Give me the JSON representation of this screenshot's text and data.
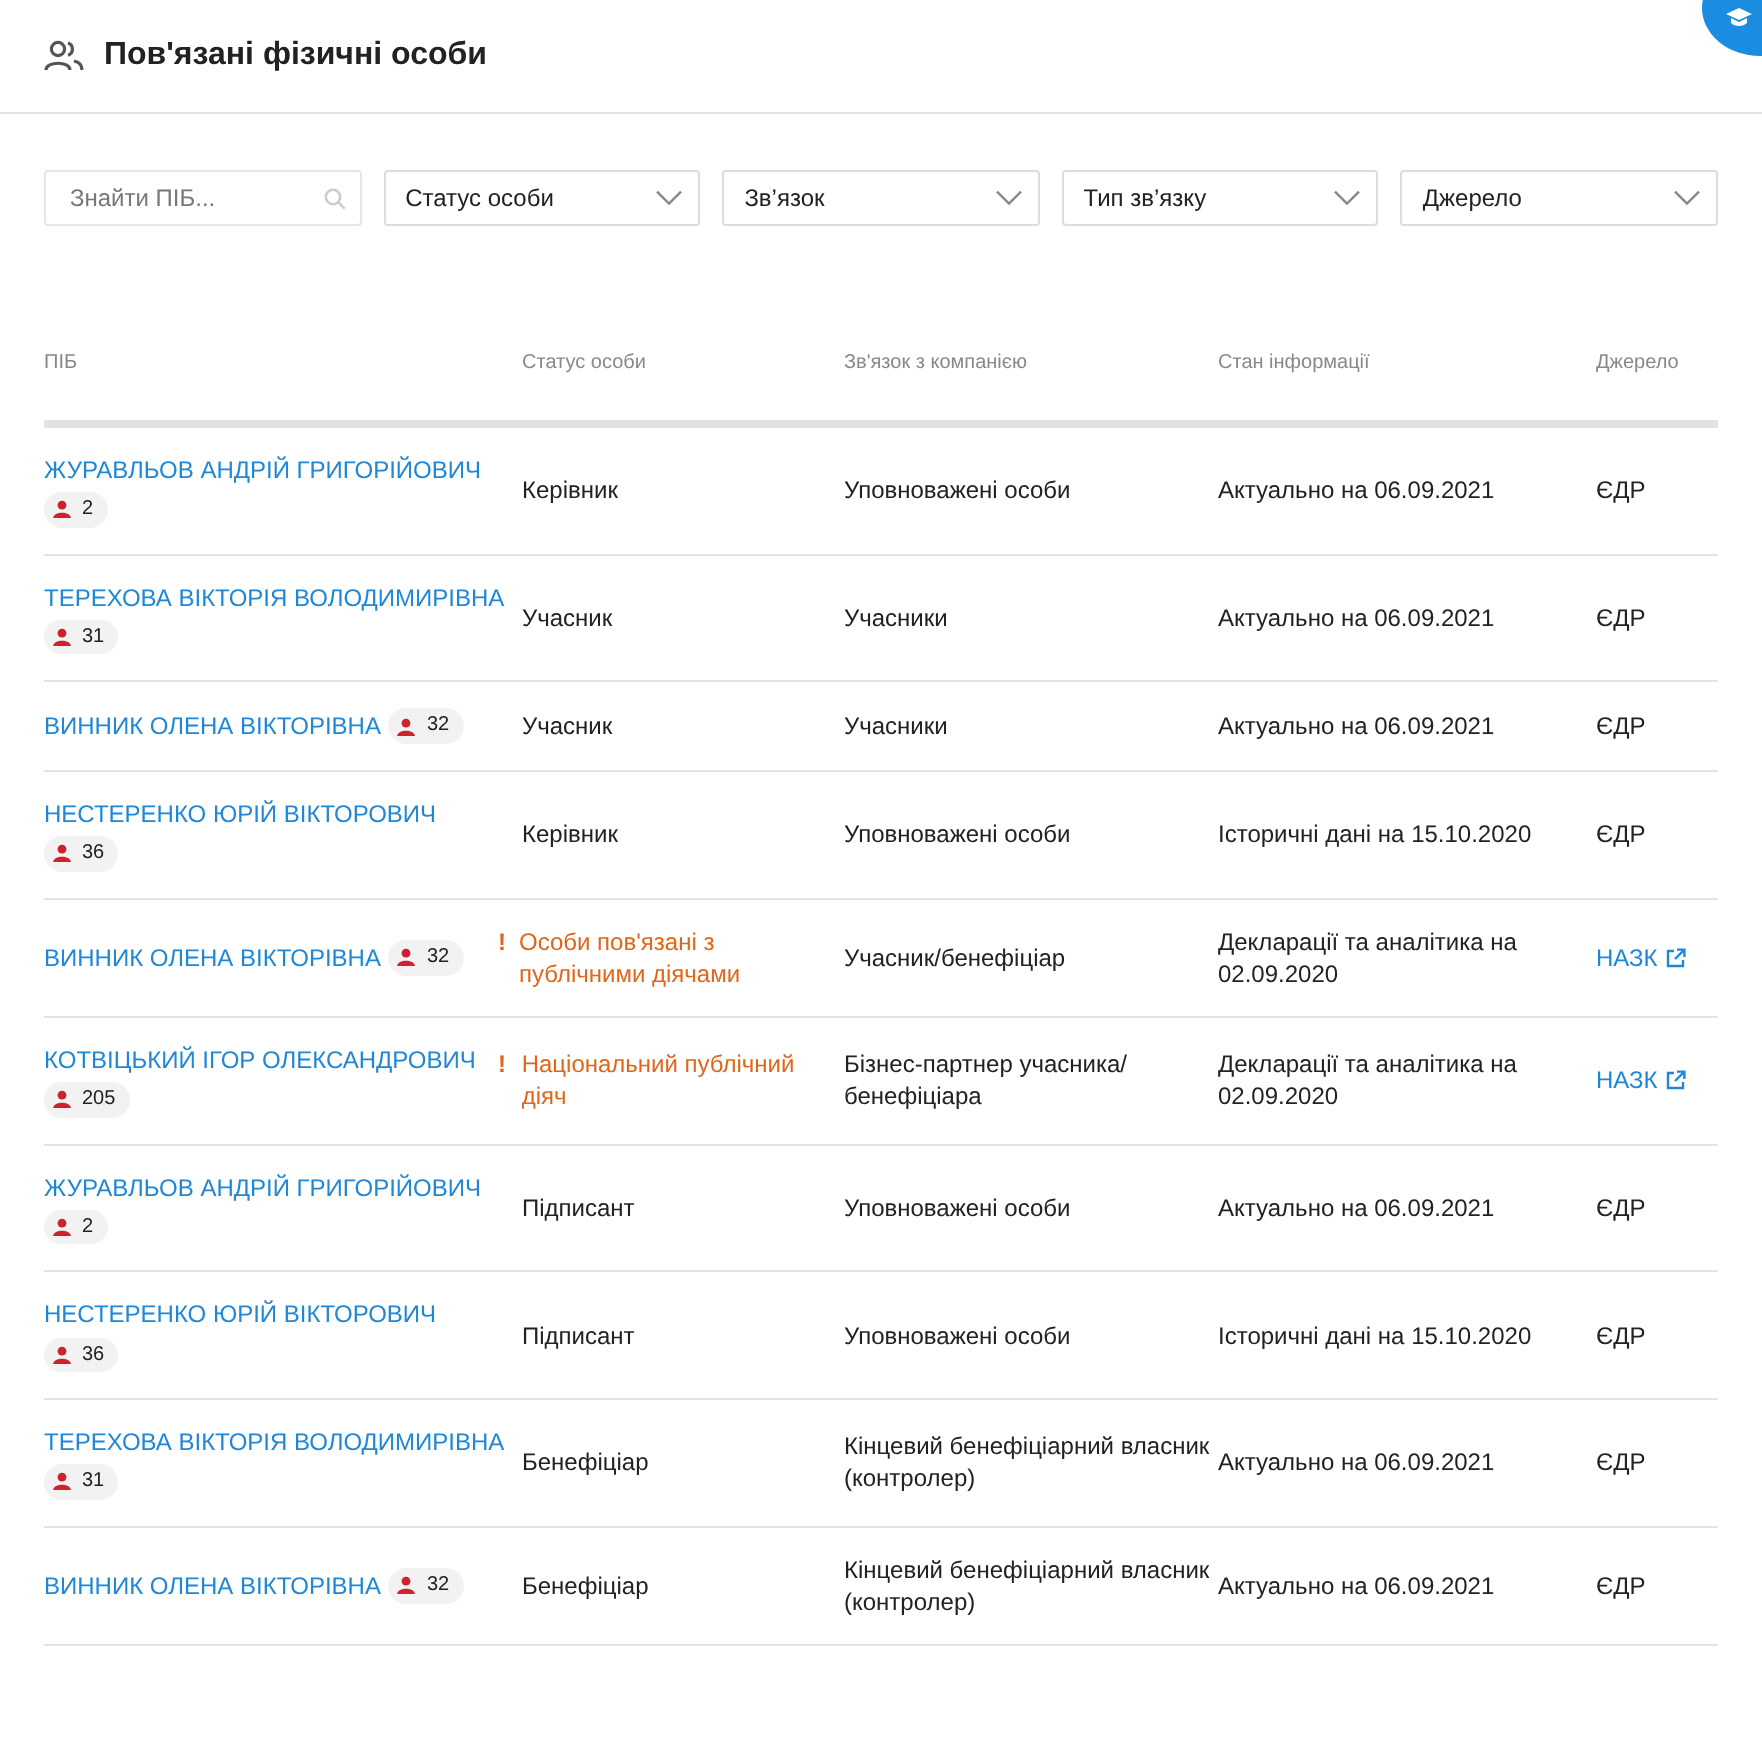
{
  "header": {
    "title": "Пов'язані фізичні особи"
  },
  "filters": [
    {
      "kind": "search",
      "placeholder": "Знайти ПІБ..."
    },
    {
      "kind": "select",
      "label": "Статус особи"
    },
    {
      "kind": "select",
      "label": "Зв’язок"
    },
    {
      "kind": "select",
      "label": "Тип зв’язку"
    },
    {
      "kind": "select",
      "label": "Джерело"
    }
  ],
  "table": {
    "columns": [
      "ПІБ",
      "Статус особи",
      "Зв'язок з компанією",
      "Стан інформації",
      "Джерело"
    ],
    "rows": [
      {
        "name": "ЖУРАВЛЬОВ АНДРІЙ ГРИГОРІЙОВИЧ",
        "count": "2",
        "status": "Керівник",
        "warning": false,
        "relation": "Уповноважені особи",
        "info": "Актуально на 06.09.2021",
        "source": "ЄДР",
        "external": false
      },
      {
        "name": "ТЕРЕХОВА ВІКТОРІЯ ВОЛОДИМИРІВНА",
        "count": "31",
        "status": "Учасник",
        "warning": false,
        "relation": "Учасники",
        "info": "Актуально на 06.09.2021",
        "source": "ЄДР",
        "external": false
      },
      {
        "name": "ВИННИК ОЛЕНА ВІКТОРІВНА",
        "count": "32",
        "status": "Учасник",
        "warning": false,
        "relation": "Учасники",
        "info": "Актуально на 06.09.2021",
        "source": "ЄДР",
        "external": false
      },
      {
        "name": "НЕСТЕРЕНКО ЮРІЙ ВІКТОРОВИЧ",
        "count": "36",
        "status": "Керівник",
        "warning": false,
        "relation": "Уповноважені особи",
        "info": "Історичні дані на 15.10.2020",
        "source": "ЄДР",
        "external": false
      },
      {
        "name": "ВИННИК ОЛЕНА ВІКТОРІВНА",
        "count": "32",
        "status": "Особи пов'язані з публічними діячами",
        "warning": true,
        "warning_mark": "!",
        "relation": "Учасник/бенефіціар",
        "info": "Декларації та аналітика на 02.09.2020",
        "source": "НАЗК",
        "external": true
      },
      {
        "name": "КОТВІЦЬКИЙ ІГОР ОЛЕКСАНДРОВИЧ",
        "count": "205",
        "status": "Національний публічний діяч",
        "warning": true,
        "warning_mark": "!",
        "relation": "Бізнес-партнер учасника/ бенефіціара",
        "info": "Декларації та аналітика на 02.09.2020",
        "source": "НАЗК",
        "external": true
      },
      {
        "name": "ЖУРАВЛЬОВ АНДРІЙ ГРИГОРІЙОВИЧ",
        "count": "2",
        "status": "Підписант",
        "warning": false,
        "relation": "Уповноважені особи",
        "info": "Актуально на 06.09.2021",
        "source": "ЄДР",
        "external": false
      },
      {
        "name": "НЕСТЕРЕНКО ЮРІЙ ВІКТОРОВИЧ",
        "count": "36",
        "status": "Підписант",
        "warning": false,
        "relation": "Уповноважені особи",
        "info": "Історичні дані на 15.10.2020",
        "source": "ЄДР",
        "external": false
      },
      {
        "name": "ТЕРЕХОВА ВІКТОРІЯ ВОЛОДИМИРІВНА",
        "count": "31",
        "status": "Бенефіціар",
        "warning": false,
        "relation": "Кінцевий бенефіціарний власник (контролер)",
        "info": "Актуально на 06.09.2021",
        "source": "ЄДР",
        "external": false
      },
      {
        "name": "ВИННИК ОЛЕНА ВІКТОРІВНА",
        "count": "32",
        "status": "Бенефіціар",
        "warning": false,
        "relation": "Кінцевий бенефіціарний власник (контролер)",
        "info": "Актуально на 06.09.2021",
        "source": "ЄДР",
        "external": false
      }
    ]
  }
}
